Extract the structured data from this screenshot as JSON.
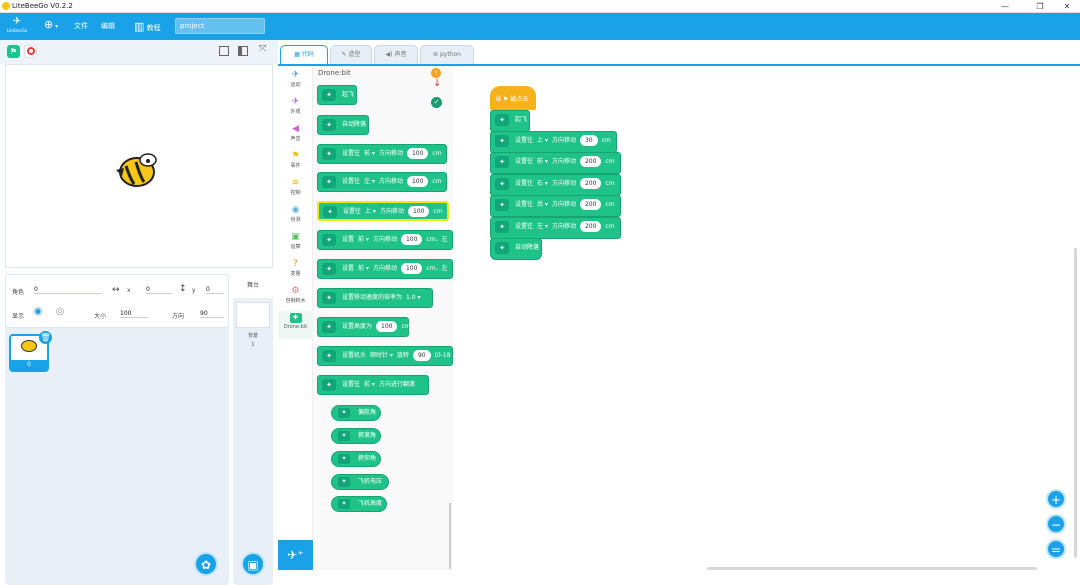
{
  "app": {
    "title": "LiteBeeGo V0.2.2",
    "logo_label": "LiteBeeGo"
  },
  "window_controls": {
    "minimize": "—",
    "maximize": "❐",
    "close": "✕"
  },
  "menu": {
    "globe_icon": "globe-icon",
    "file": "文件",
    "edit": "编辑",
    "tutorial": "教程",
    "project_name": "project"
  },
  "stage_toolbar": {
    "run_icon": "green-flag-icon",
    "stop_icon": "stop-icon"
  },
  "sprite_props": {
    "role_label": "角色",
    "role_value": "0",
    "x_label": "x",
    "x_value": "0",
    "y_label": "y",
    "y_value": "0",
    "show_label": "显示",
    "size_label": "大小",
    "size_value": "100",
    "direction_label": "方向",
    "direction_value": "90"
  },
  "sprite_card": {
    "name": "0"
  },
  "bg_panel": {
    "stage_label": "舞台",
    "bg_label": "背景",
    "bg_count": "1"
  },
  "tabs": [
    {
      "label": "代码",
      "icon": "code-icon"
    },
    {
      "label": "造型",
      "icon": "brush-icon"
    },
    {
      "label": "声音",
      "icon": "speaker-icon"
    },
    {
      "label": "python",
      "icon": "python-icon"
    }
  ],
  "categories": [
    {
      "label": "运动",
      "color": "#4c97ff",
      "glyph": "✈"
    },
    {
      "label": "外观",
      "color": "#9966ff",
      "glyph": "✈"
    },
    {
      "label": "声音",
      "color": "#cf63cf",
      "glyph": "◀"
    },
    {
      "label": "事件",
      "color": "#ffbf00",
      "glyph": "⚑"
    },
    {
      "label": "控制",
      "color": "#ffab19",
      "glyph": "≋"
    },
    {
      "label": "侦测",
      "color": "#5cb1d6",
      "glyph": "◉"
    },
    {
      "label": "运算",
      "color": "#59c059",
      "glyph": "▣"
    },
    {
      "label": "变量",
      "color": "#ff8c1a",
      "glyph": "?"
    },
    {
      "label": "自制积木",
      "color": "#ff6680",
      "glyph": "⚙"
    },
    {
      "label": "Drone:bit",
      "color": "#1fc38a",
      "glyph": "✦"
    }
  ],
  "palette": {
    "title": "Drone:bit",
    "blocks": [
      {
        "text": "起飞"
      },
      {
        "text": "自动降落"
      },
      {
        "pre": "设置往",
        "dd": "前 ▾",
        "mid": "方向移动",
        "val": "100",
        "post": "cm"
      },
      {
        "pre": "设置往",
        "dd": "左 ▾",
        "mid": "方向移动",
        "val": "100",
        "post": "cm"
      },
      {
        "pre": "设置往",
        "dd": "上 ▾",
        "mid": "方向移动",
        "val": "100",
        "post": "cm"
      },
      {
        "pre": "设置",
        "dd": "前 ▾",
        "mid": "方向移动",
        "val": "100",
        "post": "cm、左"
      },
      {
        "pre": "设置",
        "dd": "前 ▾",
        "mid": "方向移动",
        "val": "100",
        "post": "cm、左"
      },
      {
        "pre": "设置移动速度的倍率为",
        "dd": "1.0 ▾"
      },
      {
        "pre": "设置高度为",
        "val": "100",
        "post": "cm"
      },
      {
        "pre": "设置机头",
        "dd": "顺时针 ▾",
        "mid": "旋转",
        "val": "90",
        "post": "(0-18"
      },
      {
        "pre": "设置往",
        "dd": "前 ▾",
        "mid": "方向进行翻滚"
      }
    ],
    "reporters": [
      "偏航角",
      "俯滚角",
      "俯仰角",
      "飞机电压",
      "飞机高度"
    ]
  },
  "script": {
    "hat": "当 ⚑ 被点击",
    "blocks": [
      {
        "text": "起飞"
      },
      {
        "pre": "设置往",
        "dd": "上 ▾",
        "mid": "方向移动",
        "val": "30",
        "post": "cm"
      },
      {
        "pre": "设置往",
        "dd": "前 ▾",
        "mid": "方向移动",
        "val": "200",
        "post": "cm"
      },
      {
        "pre": "设置往",
        "dd": "右 ▾",
        "mid": "方向移动",
        "val": "200",
        "post": "cm"
      },
      {
        "pre": "设置往",
        "dd": "后 ▾",
        "mid": "方向移动",
        "val": "200",
        "post": "cm"
      },
      {
        "pre": "设置往",
        "dd": "左 ▾",
        "mid": "方向移动",
        "val": "200",
        "post": "cm"
      },
      {
        "text": "自动降落"
      }
    ]
  },
  "zoom": {
    "in": "+",
    "out": "−",
    "reset": "="
  }
}
